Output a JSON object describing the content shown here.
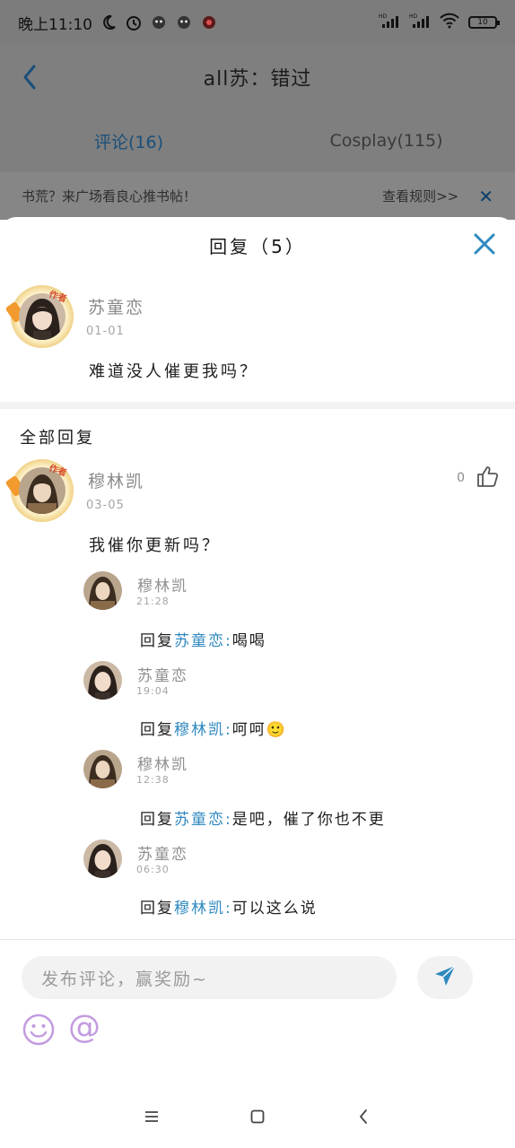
{
  "status_bar": {
    "time": "晚上11:10",
    "signal1_label": "HD",
    "signal2_label": "HD",
    "battery": "10"
  },
  "page": {
    "title": "all苏：错过",
    "tabs": [
      {
        "label": "评论(16)",
        "active": true
      },
      {
        "label": "Cosplay(115)",
        "active": false
      }
    ],
    "notice": {
      "text": "书荒？来广场看良心推书帖！",
      "rule_link": "查看规则>>"
    }
  },
  "sheet": {
    "title": "回复（5）",
    "post": {
      "author": "苏童恋",
      "badge": "作者",
      "date": "01-01",
      "text": "难道没人催更我吗？"
    },
    "section_title": "全部回复",
    "reply": {
      "author": "穆林凯",
      "badge": "作者",
      "date": "03-05",
      "text": "我催你更新吗？",
      "likes": "0"
    },
    "sub_replies": [
      {
        "author": "穆林凯",
        "time": "21:28",
        "prefix": "回复",
        "to": "苏童恋:",
        "text": "喝喝"
      },
      {
        "author": "苏童恋",
        "time": "19:04",
        "prefix": "回复",
        "to": "穆林凯:",
        "text": "呵呵🙂"
      },
      {
        "author": "穆林凯",
        "time": "12:38",
        "prefix": "回复",
        "to": "苏童恋:",
        "text": "是吧，催了你也不更"
      },
      {
        "author": "苏童恋",
        "time": "06:30",
        "prefix": "回复",
        "to": "穆林凯:",
        "text": "可以这么说"
      }
    ]
  },
  "composer": {
    "placeholder": "发布评论，赢奖励~",
    "at_label": "@"
  },
  "colors": {
    "accent_blue": "#2e88bf",
    "mention_blue": "#2e88bf",
    "emoji_purple": "#c39be0"
  },
  "icons": [
    "back-arrow-icon",
    "close-icon",
    "like-icon",
    "send-icon",
    "emoji-icon",
    "menu-icon",
    "home-icon",
    "back-icon"
  ]
}
